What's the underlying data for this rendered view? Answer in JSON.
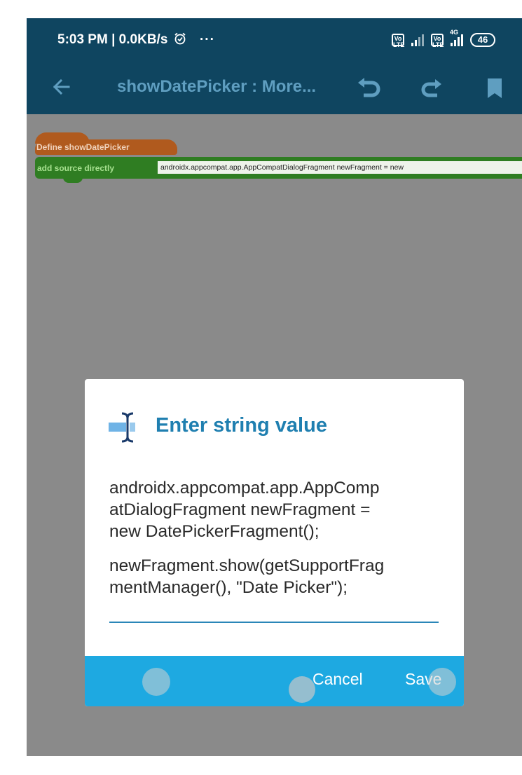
{
  "status_bar": {
    "time_speed": "5:03 PM | 0.0KB/s",
    "more": "···",
    "sim1_badge": "Vo LTE",
    "sim2_badge": "Vo LTE",
    "network": "4G",
    "battery": "46"
  },
  "app_bar": {
    "title": "showDatePicker : More..."
  },
  "workspace": {
    "define_block_label": "Define showDatePicker",
    "source_block_label": "add source directly",
    "source_block_value": "androidx.appcompat.app.AppCompatDialogFragment newFragment = new"
  },
  "dialog": {
    "title": "Enter string value",
    "input_lines": [
      "androidx.appcompat.app.AppComp",
      "atDialogFragment newFragment =",
      "new DatePickerFragment();",
      "newFragment.show(getSupportFrag",
      "mentManager(), \"Date Picker\");"
    ],
    "cancel_label": "Cancel",
    "save_label": "Save"
  },
  "colors": {
    "top_bar": "#0f4560",
    "app_title": "#5f9ec0",
    "workspace_bg": "#8a8a8a",
    "define_block": "#b05a1e",
    "source_block": "#2f7d22",
    "dialog_title": "#1f7fb0",
    "dialog_actions": "#1ea9e1"
  },
  "icons": {
    "back": "arrow-left-icon",
    "undo": "undo-icon",
    "redo": "redo-icon",
    "bookmark": "bookmark-icon",
    "dialog": "text-cursor-icon"
  }
}
